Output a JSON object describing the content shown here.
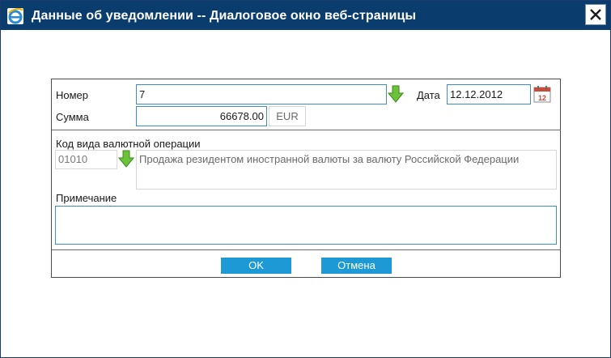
{
  "window": {
    "title": "Данные об уведомлении -- Диалоговое окно веб-страницы"
  },
  "form": {
    "number_label": "Номер",
    "number_value": "7",
    "date_label": "Дата",
    "date_value": "12.12.2012",
    "amount_label": "Сумма",
    "amount_value": "66678.00",
    "currency": "EUR",
    "op_code_label": "Код вида валютной операции",
    "op_code_value": "01010",
    "op_description": "Продажа резидентом иностранной валюты за валюту Российской Федерации",
    "note_label": "Примечание",
    "note_value": ""
  },
  "buttons": {
    "ok": "OK",
    "cancel": "Отмена"
  },
  "colors": {
    "titlebar": "#0a3d6e",
    "button": "#1d9ad6",
    "field_border": "#3c8fc0"
  }
}
